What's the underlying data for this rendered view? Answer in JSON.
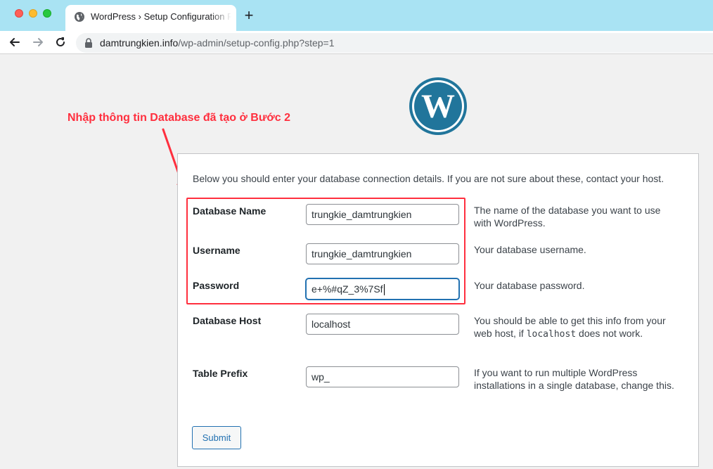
{
  "browser": {
    "tab_title": "WordPress › Setup Configuration File",
    "new_tab_label": "+",
    "url_host": "damtrungkien.info",
    "url_path": "/wp-admin/setup-config.php?step=1"
  },
  "annotation": {
    "text": "Nhập thông tin Database đã tạo ở Bước 2",
    "color": "#ff2f3e"
  },
  "form": {
    "intro": "Below you should enter your database connection details. If you are not sure about these, contact your host.",
    "fields": [
      {
        "label": "Database Name",
        "value": "trungkie_damtrungkien",
        "desc": "The name of the database you want to use with WordPress."
      },
      {
        "label": "Username",
        "value": "trungkie_damtrungkien",
        "desc": "Your database username."
      },
      {
        "label": "Password",
        "value": "e+%#qZ_3%7Sf",
        "desc": "Your database password."
      },
      {
        "label": "Database Host",
        "value": "localhost",
        "desc_pre": "You should be able to get this info from your web host, if ",
        "desc_code": "localhost",
        "desc_post": " does not work."
      },
      {
        "label": "Table Prefix",
        "value": "wp_",
        "desc": "If you want to run multiple WordPress installations in a single database, change this."
      }
    ],
    "submit_label": "Submit"
  },
  "icons": {
    "tab": "globe-icon",
    "back": "back-arrow-icon",
    "forward": "forward-arrow-icon",
    "reload": "reload-icon",
    "secure": "lock-icon",
    "brand": "wordpress-logo"
  },
  "colors": {
    "wp_blue": "#21759b",
    "accent": "#2271b1",
    "tab_bar": "#a9e3f3"
  }
}
